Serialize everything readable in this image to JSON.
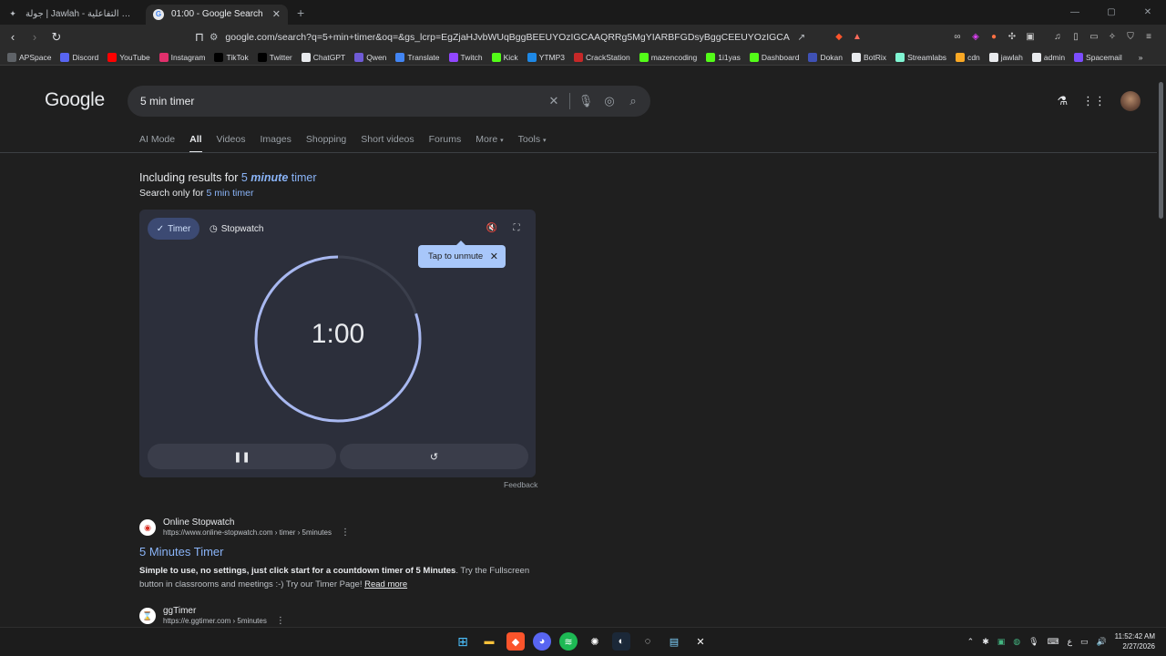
{
  "browser": {
    "tabs": [
      {
        "title": "جولة | Jawlah - منصة الألعاب التفاعلية",
        "active": false
      },
      {
        "title": "01:00 - Google Search",
        "active": true
      }
    ],
    "new_tab": "+",
    "url": "google.com/search?q=5+min+timer&oq=&gs_lcrp=EgZjaHJvbWUqBggBEEUYOzIGCAAQRRg5MgYIARBFGDsyBggCEEUYOzIGCAMQRRg9MgYIBBBF...",
    "bookmarks": [
      {
        "label": "APSpace",
        "color": "#5f6368"
      },
      {
        "label": "Discord",
        "color": "#5865f2"
      },
      {
        "label": "YouTube",
        "color": "#ff0000"
      },
      {
        "label": "Instagram",
        "color": "#e1306c"
      },
      {
        "label": "TikTok",
        "color": "#000000"
      },
      {
        "label": "Twitter",
        "color": "#000000"
      },
      {
        "label": "ChatGPT",
        "color": "#e8eaed"
      },
      {
        "label": "Qwen",
        "color": "#6f5bd6"
      },
      {
        "label": "Translate",
        "color": "#4285f4"
      },
      {
        "label": "Twitch",
        "color": "#9146ff"
      },
      {
        "label": "Kick",
        "color": "#53fc18"
      },
      {
        "label": "YTMP3",
        "color": "#1e88e5"
      },
      {
        "label": "CrackStation",
        "color": "#c62828"
      },
      {
        "label": "mazencoding",
        "color": "#53fc18"
      },
      {
        "label": "1i1yas",
        "color": "#53fc18"
      },
      {
        "label": "Dashboard",
        "color": "#53fc18"
      },
      {
        "label": "Dokan",
        "color": "#3f51b5"
      },
      {
        "label": "BotRix",
        "color": "#e8eaed"
      },
      {
        "label": "Streamlabs",
        "color": "#80f5d2"
      },
      {
        "label": "cdn",
        "color": "#f9a825"
      },
      {
        "label": "jawlah",
        "color": "#e8eaed"
      },
      {
        "label": "admin",
        "color": "#e8eaed"
      },
      {
        "label": "Spacemail",
        "color": "#7c4dff"
      }
    ]
  },
  "google": {
    "logo": "Google",
    "query": "5 min timer",
    "tabs": [
      "AI Mode",
      "All",
      "Videos",
      "Images",
      "Shopping",
      "Short videos",
      "Forums",
      "More",
      "Tools"
    ],
    "active_tab": "All",
    "including_prefix": "Including results for ",
    "including_num": "5 ",
    "including_em": "minute",
    "including_tail": " timer",
    "search_only_prefix": "Search only for ",
    "search_only_link": "5 min timer"
  },
  "timer": {
    "timer_label": "Timer",
    "stopwatch_label": "Stopwatch",
    "tooltip": "Tap to unmute",
    "time": "1:00",
    "remaining_fraction": 0.2,
    "feedback": "Feedback"
  },
  "results": [
    {
      "site_name": "Online Stopwatch",
      "url": "https://www.online-stopwatch.com › timer › 5minutes",
      "title": "5 Minutes Timer",
      "snippet_bold": "Simple to use, no settings, just click start for a countdown timer of 5 Minutes",
      "snippet_rest": ". Try the Fullscreen button in classrooms and meetings :-) Try our Timer Page!",
      "read_more": "Read more"
    },
    {
      "site_name": "ggTimer",
      "url": "https://e.ggtimer.com › 5minutes"
    }
  ],
  "taskbar": {
    "time": "11:52:42 AM",
    "date": "2/27/2026",
    "lang": "ع"
  }
}
